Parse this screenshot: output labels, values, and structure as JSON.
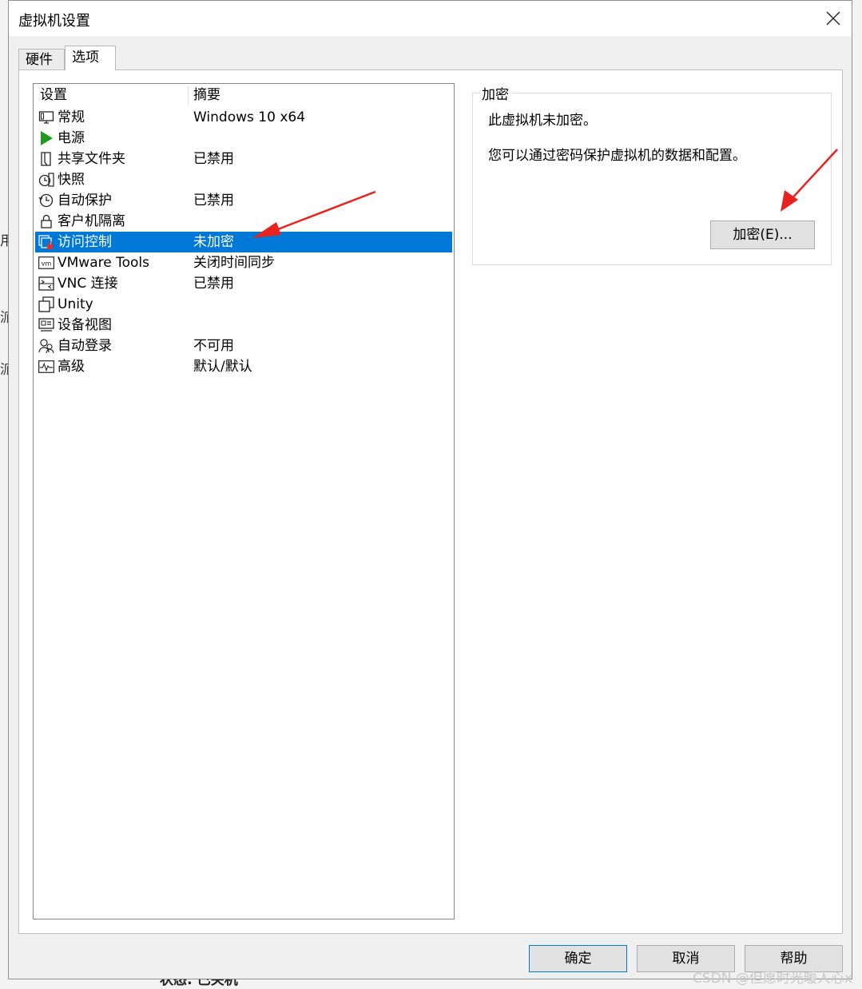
{
  "background": {
    "fragments": [
      "用",
      "派",
      "派"
    ],
    "bottom_text": "状态: 已关机"
  },
  "window": {
    "title": "虚拟机设置",
    "tabs": [
      {
        "label": "硬件",
        "active": false
      },
      {
        "label": "选项",
        "active": true
      }
    ],
    "list": {
      "headers": {
        "setting": "设置",
        "summary": "摘要"
      },
      "selected_index": 6,
      "rows": [
        {
          "name": "常规",
          "summary": "Windows 10 x64",
          "icon": "monitor-icon"
        },
        {
          "name": "电源",
          "summary": "",
          "icon": "play-icon"
        },
        {
          "name": "共享文件夹",
          "summary": "已禁用",
          "icon": "shared-folder-icon"
        },
        {
          "name": "快照",
          "summary": "",
          "icon": "snapshot-icon"
        },
        {
          "name": "自动保护",
          "summary": "已禁用",
          "icon": "clock-icon"
        },
        {
          "name": "客户机隔离",
          "summary": "",
          "icon": "lock-icon"
        },
        {
          "name": "访问控制",
          "summary": "未加密",
          "icon": "access-control-icon"
        },
        {
          "name": "VMware Tools",
          "summary": "关闭时间同步",
          "icon": "vm-icon"
        },
        {
          "name": "VNC 连接",
          "summary": "已禁用",
          "icon": "vnc-icon"
        },
        {
          "name": "Unity",
          "summary": "",
          "icon": "unity-icon"
        },
        {
          "name": "设备视图",
          "summary": "",
          "icon": "device-view-icon"
        },
        {
          "name": "自动登录",
          "summary": "不可用",
          "icon": "users-icon"
        },
        {
          "name": "高级",
          "summary": "默认/默认",
          "icon": "pulse-icon"
        }
      ]
    },
    "encryption": {
      "group_label": "加密",
      "status_text": "此虚拟机未加密。",
      "info_text": "您可以通过密码保护虚拟机的数据和配置。",
      "encrypt_button": "加密(E)..."
    },
    "footer": {
      "ok": "确定",
      "cancel": "取消",
      "help": "帮助"
    }
  },
  "watermark": "CSDN @但愿时光暖人心x",
  "colors": {
    "selection": "#0078d7",
    "annotation_arrow": "#e8231f",
    "power_icon": "#1e9a1e"
  }
}
